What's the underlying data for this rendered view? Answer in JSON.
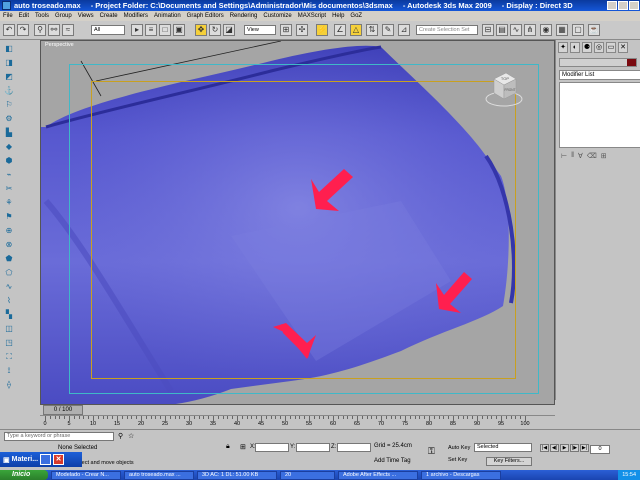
{
  "window": {
    "file": "auto troseado.max",
    "project": "- Project Folder: C:\\Documents and Settings\\Administrador\\Mis documentos\\3dsmax",
    "app": "- Autodesk 3ds Max  2009",
    "display": "- Display : Direct 3D"
  },
  "menu": [
    "File",
    "Edit",
    "Tools",
    "Group",
    "Views",
    "Create",
    "Modifiers",
    "Animation",
    "Graph Editors",
    "Rendering",
    "Customize",
    "MAXScript",
    "Help",
    "GoZ"
  ],
  "toolbar": {
    "filter_value": "All",
    "view_value": "View",
    "selection_set_placeholder": "Create Selection Set"
  },
  "viewport": {
    "label": "Perspective",
    "viewcube_label": "TOP",
    "viewcube_front": "FRONT",
    "object_color": "#5556cc",
    "arrow_color": "#ff1f4f"
  },
  "timeline": {
    "frame_slider": "0 / 100",
    "ticks": [
      0,
      5,
      10,
      15,
      20,
      25,
      30,
      35,
      40,
      45,
      50,
      55,
      60,
      65,
      70,
      75,
      80,
      85,
      90,
      95,
      100
    ]
  },
  "command_panel": {
    "modifier_list": "Modifier List",
    "name_swatch_color": "#7a0a10"
  },
  "status": {
    "search_placeholder": "Type a keyword or phrase",
    "selection": "None Selected",
    "prompt": "drag to select and move objects",
    "x_label": "X:",
    "y_label": "Y:",
    "z_label": "Z:",
    "grid": "Grid = 25.4cm",
    "add_time_tag": "Add Time Tag",
    "auto_key": "Auto Key",
    "set_key": "Set Key",
    "selected_dropdown": "Selected",
    "key_filters": "Key Filters...",
    "frame": "0"
  },
  "materials_bar": {
    "label": "Materi..."
  },
  "taskbar": {
    "start": "Inicio",
    "items": [
      "Modelado - Crear N...",
      "auto troseado.max ...",
      "3D AC: 1 DL: 51.00 KB",
      "20",
      "Adobe After Effects ...",
      "1 archivo - Descargas"
    ],
    "clock": "15:54"
  }
}
